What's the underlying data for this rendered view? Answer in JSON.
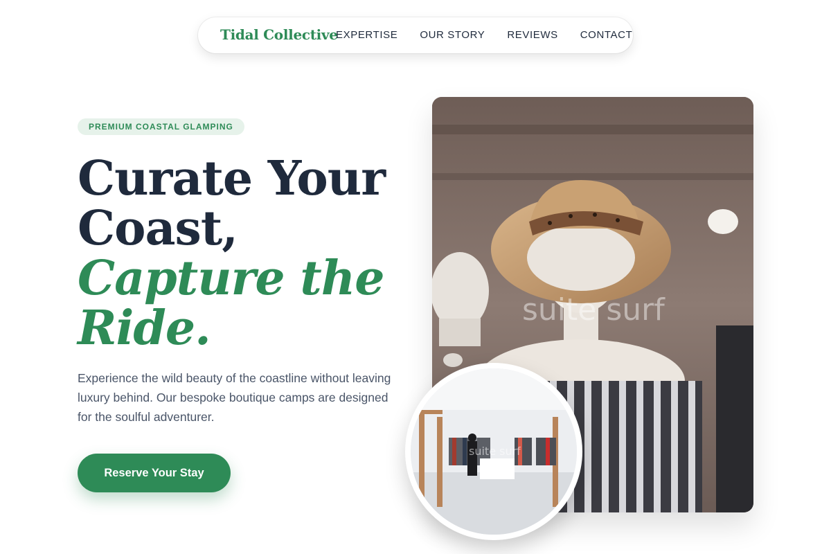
{
  "nav": {
    "brand": "Tidal Collective",
    "links": [
      "EXPERTISE",
      "OUR STORY",
      "REVIEWS",
      "CONTACT"
    ]
  },
  "hero": {
    "badge": "PREMIUM COASTAL GLAMPING",
    "headline_line1": "Curate Your",
    "headline_line2": "Coast,",
    "headline_accent_line1": "Capture the",
    "headline_accent_line2": "Ride.",
    "description": "Experience the wild beauty of the coastline without leaving luxury behind. Our bespoke boutique camps are designed for the soulful adventurer.",
    "cta_label": "Reserve Your Stay"
  },
  "images": {
    "main_watermark": "suite surf",
    "inset_watermark": "suite surf"
  },
  "colors": {
    "accent": "#2e8b57",
    "text": "#1f2a3c",
    "badge_bg": "#e6f2ea"
  }
}
